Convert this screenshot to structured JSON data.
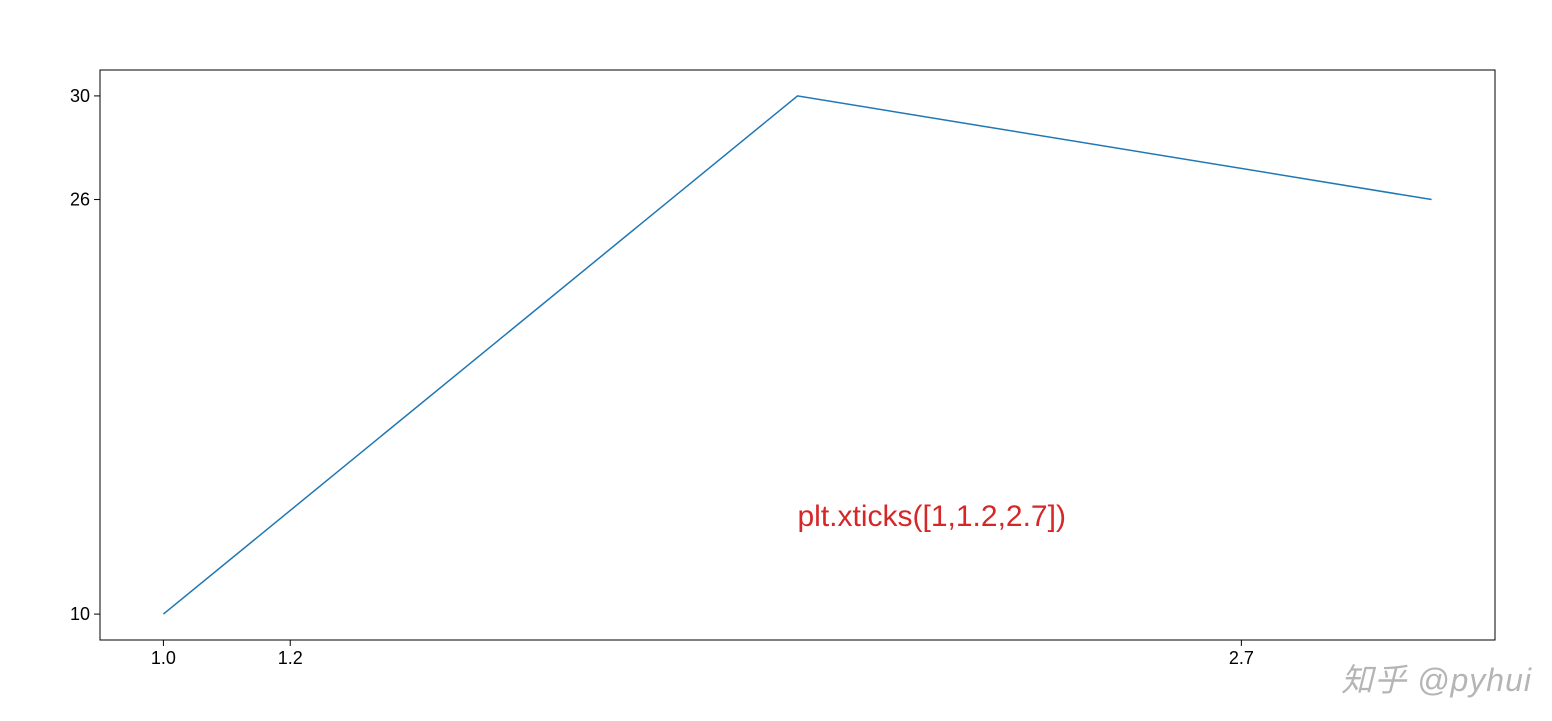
{
  "chart_data": {
    "type": "line",
    "x": [
      1.0,
      2.0,
      3.0
    ],
    "y": [
      10,
      30,
      26
    ],
    "xticks": [
      1.0,
      1.2,
      2.7
    ],
    "xtick_labels": [
      "1.0",
      "1.2",
      "2.7"
    ],
    "yticks": [
      10,
      26,
      30
    ],
    "ytick_labels": [
      "10",
      "26",
      "30"
    ],
    "xlim": [
      0.9,
      3.1
    ],
    "ylim": [
      9,
      31
    ],
    "line_color": "#1f77b4",
    "annotation": {
      "text": "plt.xticks([1,1.2,2.7])",
      "color": "#d62728",
      "pos_fraction_x": 0.5,
      "pos_fraction_y": 0.8
    }
  },
  "watermark": "知乎 @pyhui"
}
